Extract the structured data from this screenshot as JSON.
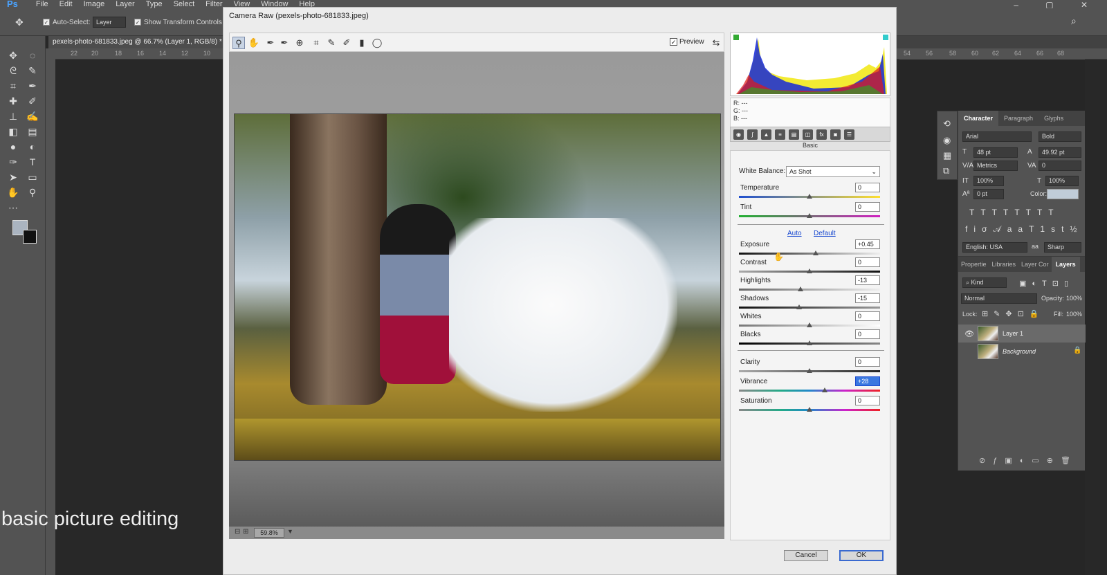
{
  "menubar": {
    "logo": "Ps",
    "items": [
      "File",
      "Edit",
      "Image",
      "Layer",
      "Type",
      "Select",
      "Filter",
      "View",
      "Window",
      "Help"
    ]
  },
  "options": {
    "auto_select": "Auto-Select:",
    "layer_value": "Layer",
    "show_transform": "Show Transform Controls"
  },
  "document_tab": "pexels-photo-681833.jpeg @ 66.7% (Layer 1, RGB/8) *",
  "ruler_labels": [
    "22",
    "20",
    "18",
    "16",
    "14",
    "12",
    "10"
  ],
  "right_ruler_labels": [
    "54",
    "56",
    "58",
    "60",
    "62",
    "64",
    "66",
    "68"
  ],
  "caption": "basic picture editing",
  "dialog": {
    "title": "Camera Raw (pexels-photo-681833.jpeg)",
    "preview_label": "Preview",
    "zoom": "59.8%",
    "rgb": {
      "r": "R:",
      "g": "G:",
      "b": "B:",
      "dash": "---"
    },
    "panel_name": "Basic",
    "white_balance_label": "White Balance:",
    "white_balance_value": "As Shot",
    "auto": "Auto",
    "default": "Default",
    "controls": [
      {
        "label": "Temperature",
        "value": "0"
      },
      {
        "label": "Tint",
        "value": "0"
      },
      {
        "label": "Exposure",
        "value": "+0.45"
      },
      {
        "label": "Contrast",
        "value": "0"
      },
      {
        "label": "Highlights",
        "value": "-13"
      },
      {
        "label": "Shadows",
        "value": "-15"
      },
      {
        "label": "Whites",
        "value": "0"
      },
      {
        "label": "Blacks",
        "value": "0"
      },
      {
        "label": "Clarity",
        "value": "0"
      },
      {
        "label": "Vibrance",
        "value": "+28"
      },
      {
        "label": "Saturation",
        "value": "0"
      }
    ],
    "cancel": "Cancel",
    "ok": "OK"
  },
  "character": {
    "tabs": [
      "Character",
      "Paragraph",
      "Glyphs"
    ],
    "font": "Arial",
    "style": "Bold",
    "size": "48 pt",
    "leading": "49.92 pt",
    "kerning": "Metrics",
    "tracking": "0",
    "vscale": "100%",
    "hscale": "100%",
    "baseline": "0 pt",
    "color_label": "Color:",
    "language": "English: USA",
    "aa": "Sharp"
  },
  "layers": {
    "tabs": [
      "Propertie",
      "Libraries",
      "Layer Cor",
      "Layers"
    ],
    "kind": "Kind",
    "blend": "Normal",
    "opacity_label": "Opacity:",
    "opacity": "100%",
    "lock_label": "Lock:",
    "fill_label": "Fill:",
    "fill": "100%",
    "rows": [
      "Layer 1",
      "Background"
    ]
  }
}
